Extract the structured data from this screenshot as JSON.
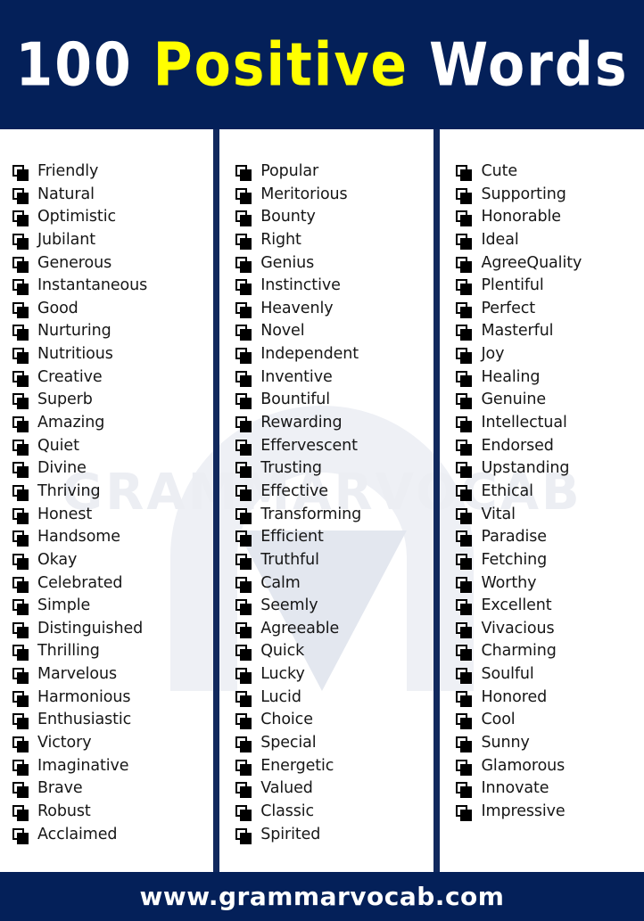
{
  "header": {
    "title_part1": "100 ",
    "title_part2": "Positive",
    "title_part3": " Words",
    "bg_color": "#042059",
    "accent_color": "#ffff00",
    "text_color": "#ffffff"
  },
  "watermark": {
    "text": "GRAMMARVOCAB",
    "color": "#eceef3"
  },
  "footer": {
    "text": "www.grammarvocab.com",
    "bg_color": "#042059",
    "text_color": "#ffffff"
  },
  "columns": [
    {
      "id": "column-1",
      "items": [
        "Friendly",
        "Natural",
        "Optimistic",
        "Jubilant",
        "Generous",
        "Instantaneous",
        "Good",
        "Nurturing",
        "Nutritious",
        "Creative",
        "Superb",
        "Amazing",
        "Quiet",
        "Divine",
        "Thriving",
        "Honest",
        "Handsome",
        "Okay",
        "Celebrated",
        "Simple",
        "Distinguished",
        "Thrilling",
        "Marvelous",
        "Harmonious",
        "Enthusiastic",
        "Victory",
        "Imaginative",
        "Brave",
        "Robust",
        "Acclaimed"
      ]
    },
    {
      "id": "column-2",
      "items": [
        "Popular",
        "Meritorious",
        "Bounty",
        "Right",
        "Genius",
        "Instinctive",
        "Heavenly",
        "Novel",
        "Independent",
        "Inventive",
        "Bountiful",
        "Rewarding",
        "Effervescent",
        "Trusting",
        "Effective",
        "Transforming",
        "Efficient",
        "Truthful",
        "Calm",
        "Seemly",
        "Agreeable",
        "Quick",
        "Lucky",
        "Lucid",
        "Choice",
        "Special",
        "Energetic",
        "Valued",
        "Classic",
        "Spirited"
      ]
    },
    {
      "id": "column-3",
      "items": [
        "Cute",
        "Supporting",
        "Honorable",
        "Ideal",
        "AgreeQuality",
        "Plentiful",
        "Perfect",
        "Masterful",
        "Joy",
        "Healing",
        "Genuine",
        "Intellectual",
        "Endorsed",
        "Upstanding",
        "Ethical",
        "Vital",
        "Paradise",
        "Fetching",
        "Worthy",
        "Excellent",
        "Vivacious",
        "Charming",
        "Soulful",
        "Honored",
        "Cool",
        "Sunny",
        "Glamorous",
        "Innovate",
        "Impressive"
      ]
    }
  ]
}
